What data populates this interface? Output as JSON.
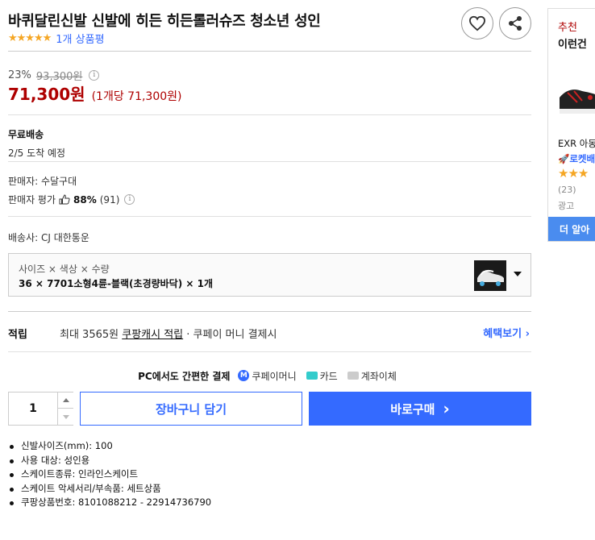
{
  "product": {
    "title": "바퀴달린신발 신발에 히든 히든롤러슈즈 청소년 성인",
    "stars": "★★★★★",
    "review_count_label": "1개 상품평"
  },
  "price": {
    "discount_rate": "23%",
    "original_price": "93,300원",
    "info_icon": "i",
    "sale_price": "71,300원",
    "unit_price": "(1개당 71,300원)"
  },
  "shipping": {
    "type": "무료배송",
    "arrival": "2/5 도착 예정"
  },
  "seller": {
    "name_label": "판매자: 수달구대",
    "rating_label": "판매자 평가",
    "rating_value": "88%",
    "rating_count": "(91)"
  },
  "carrier": {
    "label": "배송사: CJ 대한통운"
  },
  "option": {
    "label": "사이즈 × 색상 × 수량",
    "value": "36 × 7701소형4륜-블랙(초경량바닥) × 1개"
  },
  "cash": {
    "label": "적립",
    "prefix": "최대 3565원 ",
    "link": "쿠팡캐시 적립",
    "suffix": " · 쿠페이 머니 결제시",
    "benefit_link": "혜택보기 ›"
  },
  "payment": {
    "title": "PC에서도 간편한 결제",
    "coupay_icon": "M",
    "options": [
      "쿠페이머니",
      "카드",
      "계좌이체"
    ]
  },
  "purchase": {
    "quantity": "1",
    "cart_label": "장바구니 담기",
    "buy_label": "바로구매",
    "buy_arrow": "›"
  },
  "specs": [
    "신발사이즈(mm): 100",
    "사용 대상: 성인용",
    "스케이트종류: 인라인스케이트",
    "스케이트 악세서리/부속품: 세트상품",
    "쿠팡상품번호: 8101088212 - 22914736790"
  ],
  "recommend": {
    "label": "추천",
    "title": "이런건",
    "item_name": "EXR 아동",
    "rocket": "🚀로켓배",
    "stars": "★★★",
    "count": "(23)",
    "ad": "광고",
    "more_label": "더 알아"
  },
  "colors": {
    "accent": "#346aff",
    "price_red": "#ae0000",
    "star": "#f5a623"
  }
}
